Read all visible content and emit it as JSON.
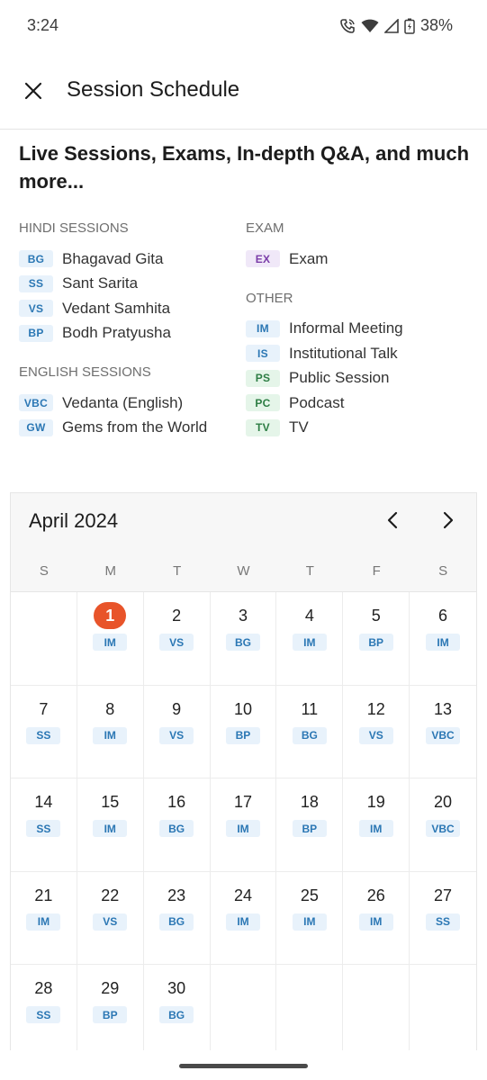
{
  "status_bar": {
    "time": "3:24",
    "battery": "38%",
    "icons": [
      "wifi-calling-icon",
      "wifi-icon",
      "signal-icon",
      "battery-icon"
    ]
  },
  "header": {
    "title": "Session Schedule",
    "close_icon": "close-icon"
  },
  "intro": "Live Sessions, Exams, In-depth Q&A, and much more...",
  "legend": {
    "hindi": {
      "heading": "HINDI SESSIONS",
      "items": [
        {
          "code": "BG",
          "label": "Bhagavad Gita"
        },
        {
          "code": "SS",
          "label": "Sant Sarita"
        },
        {
          "code": "VS",
          "label": "Vedant Samhita"
        },
        {
          "code": "BP",
          "label": "Bodh Pratyusha"
        }
      ]
    },
    "english": {
      "heading": "ENGLISH SESSIONS",
      "items": [
        {
          "code": "VBC",
          "label": "Vedanta (English)"
        },
        {
          "code": "GW",
          "label": "Gems from the World"
        }
      ]
    },
    "exam": {
      "heading": "EXAM",
      "items": [
        {
          "code": "EX",
          "label": "Exam"
        }
      ]
    },
    "other": {
      "heading": "OTHER",
      "items": [
        {
          "code": "IM",
          "label": "Informal Meeting"
        },
        {
          "code": "IS",
          "label": "Institutional Talk"
        },
        {
          "code": "PS",
          "label": "Public Session"
        },
        {
          "code": "PC",
          "label": "Podcast"
        },
        {
          "code": "TV",
          "label": "TV"
        }
      ]
    }
  },
  "calendar": {
    "month": "April 2024",
    "weekdays": [
      "S",
      "M",
      "T",
      "W",
      "T",
      "F",
      "S"
    ],
    "today": 1,
    "start_offset": 1,
    "days": [
      {
        "day": "1",
        "tag": "IM"
      },
      {
        "day": "2",
        "tag": "VS"
      },
      {
        "day": "3",
        "tag": "BG"
      },
      {
        "day": "4",
        "tag": "IM"
      },
      {
        "day": "5",
        "tag": "BP"
      },
      {
        "day": "6",
        "tag": "IM"
      },
      {
        "day": "7",
        "tag": "SS"
      },
      {
        "day": "8",
        "tag": "IM"
      },
      {
        "day": "9",
        "tag": "VS"
      },
      {
        "day": "10",
        "tag": "BP"
      },
      {
        "day": "11",
        "tag": "BG"
      },
      {
        "day": "12",
        "tag": "VS"
      },
      {
        "day": "13",
        "tag": "VBC"
      },
      {
        "day": "14",
        "tag": "SS"
      },
      {
        "day": "15",
        "tag": "IM"
      },
      {
        "day": "16",
        "tag": "BG"
      },
      {
        "day": "17",
        "tag": "IM"
      },
      {
        "day": "18",
        "tag": "BP"
      },
      {
        "day": "19",
        "tag": "IM"
      },
      {
        "day": "20",
        "tag": "VBC"
      },
      {
        "day": "21",
        "tag": "IM"
      },
      {
        "day": "22",
        "tag": "VS"
      },
      {
        "day": "23",
        "tag": "BG"
      },
      {
        "day": "24",
        "tag": "IM"
      },
      {
        "day": "25",
        "tag": "IM"
      },
      {
        "day": "26",
        "tag": "IM"
      },
      {
        "day": "27",
        "tag": "SS"
      },
      {
        "day": "28",
        "tag": "SS"
      },
      {
        "day": "29",
        "tag": "BP"
      },
      {
        "day": "30",
        "tag": "BG"
      }
    ]
  },
  "colors": {
    "today": "#e8542a",
    "tag_blue_bg": "#e8f2fb",
    "tag_blue_text": "#2b77b4",
    "tag_purple_bg": "#f0e8f8",
    "tag_green_bg": "#e5f5e9"
  }
}
